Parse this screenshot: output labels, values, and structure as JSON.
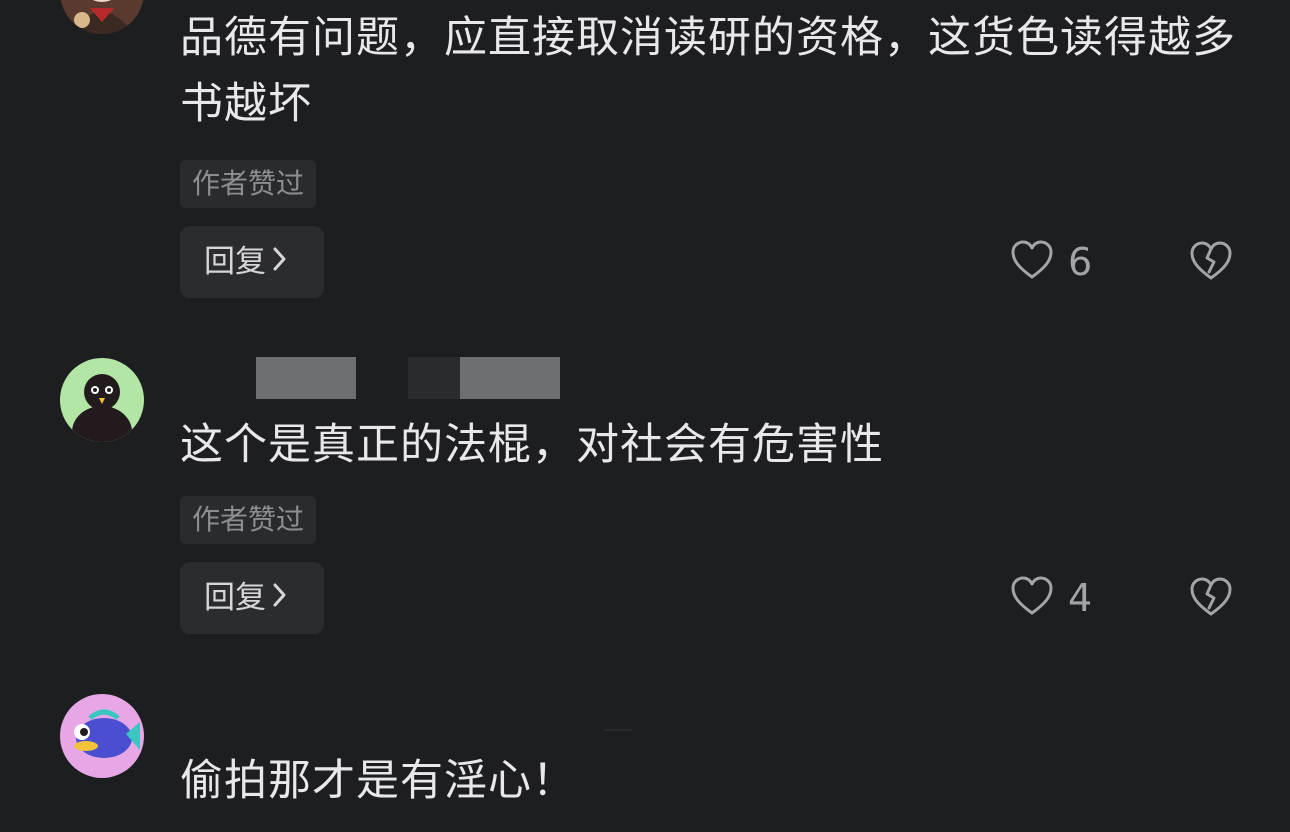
{
  "comments": [
    {
      "text": "品德有问题，应直接取消读研的资格，这货色读得越多书越坏",
      "author_badge": "作者赞过",
      "reply_label": "回复",
      "likes": "6"
    },
    {
      "text": "这个是真正的法棍，对社会有危害性",
      "author_badge": "作者赞过",
      "reply_label": "回复",
      "likes": "4"
    },
    {
      "text": "偷拍那才是有淫心！"
    }
  ],
  "icons": {
    "like": "heart-outline-icon",
    "dislike": "broken-heart-icon",
    "reply_arrow": "chevron-right-icon"
  },
  "colors": {
    "background": "#1d1e20",
    "text": "#e8e8ea",
    "muted": "#8d8e92",
    "button_bg": "#2b2c2f"
  }
}
